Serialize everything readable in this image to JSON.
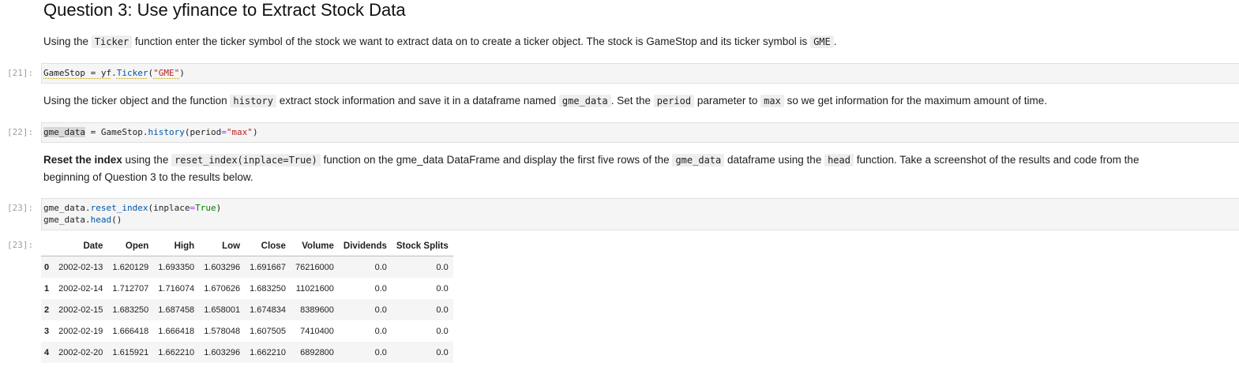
{
  "question": {
    "title": "Question 3: Use yfinance to Extract Stock Data"
  },
  "para1": {
    "t1": "Using the ",
    "c1": "Ticker",
    "t2": " function enter the ticker symbol of the stock we want to extract data on to create a ticker object. The stock is GameStop and its ticker symbol is ",
    "c2": "GME",
    "t3": "."
  },
  "cell21": {
    "prompt": "[21]:",
    "var": "GameStop",
    "eq": " = ",
    "mod": "yf",
    "dot": ".",
    "fn": "Ticker",
    "open": "(",
    "arg": "\"GME\"",
    "close": ")"
  },
  "para2": {
    "t1": "Using the ticker object and the function ",
    "c1": "history",
    "t2": " extract stock information and save it in a dataframe named ",
    "c2": "gme_data",
    "t3": ". Set the ",
    "c3": "period",
    "t4": " parameter to ",
    "c4": "max",
    "t5": " so we get information for the maximum amount of time."
  },
  "cell22": {
    "prompt": "[22]:",
    "var": "gme_data",
    "eq": " = ",
    "obj": "GameStop.",
    "fn": "history",
    "open": "(period",
    "eq2": "=",
    "arg": "\"max\"",
    "close": ")"
  },
  "para3": {
    "bold": "Reset the index",
    "t1": " using the ",
    "c1": "reset_index(inplace=True)",
    "t2": " function on the gme_data DataFrame and display the first five rows of the ",
    "c2": "gme_data",
    "t3": " dataframe using the ",
    "c3": "head",
    "t4": " function. Take a screenshot of the results and code from the",
    "line2": "beginning of Question 3 to the results below."
  },
  "cell23": {
    "prompt": "[23]:",
    "l1_obj": "gme_data.",
    "l1_fn": "reset_index",
    "l1_open": "(inplace",
    "l1_eq": "=",
    "l1_val": "True",
    "l1_close": ")",
    "l2_obj": "gme_data.",
    "l2_fn": "head",
    "l2_call": "()"
  },
  "output23": {
    "prompt": "[23]:",
    "columns": [
      "",
      "Date",
      "Open",
      "High",
      "Low",
      "Close",
      "Volume",
      "Dividends",
      "Stock Splits"
    ],
    "rows": [
      [
        "0",
        "2002-02-13",
        "1.620129",
        "1.693350",
        "1.603296",
        "1.691667",
        "76216000",
        "0.0",
        "0.0"
      ],
      [
        "1",
        "2002-02-14",
        "1.712707",
        "1.716074",
        "1.670626",
        "1.683250",
        "11021600",
        "0.0",
        "0.0"
      ],
      [
        "2",
        "2002-02-15",
        "1.683250",
        "1.687458",
        "1.658001",
        "1.674834",
        "8389600",
        "0.0",
        "0.0"
      ],
      [
        "3",
        "2002-02-19",
        "1.666418",
        "1.666418",
        "1.578048",
        "1.607505",
        "7410400",
        "0.0",
        "0.0"
      ],
      [
        "4",
        "2002-02-20",
        "1.615921",
        "1.662210",
        "1.603296",
        "1.662210",
        "6892800",
        "0.0",
        "0.0"
      ]
    ]
  }
}
